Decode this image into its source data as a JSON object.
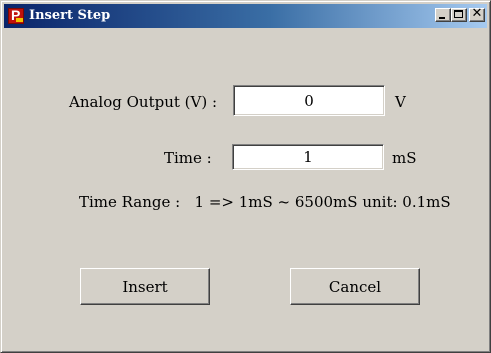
{
  "window": {
    "title": "Insert Step",
    "icon": "app-p-icon",
    "controls": {
      "minimize": "minimize-icon",
      "maximize": "maximize-icon",
      "close": "close-icon",
      "close_glyph": "✕"
    },
    "icon_letter": "P"
  },
  "form": {
    "analog_output": {
      "label": "Analog Output (V) :",
      "value": "0",
      "unit": "V"
    },
    "time": {
      "label": "Time :",
      "value": "1",
      "unit": "mS"
    },
    "time_range": "Time Range :   1 => 1mS ~ 6500mS unit: 0.1mS"
  },
  "buttons": {
    "insert": "Insert",
    "cancel": "Cancel"
  },
  "colors": {
    "title_gradient_start": "#0a246a",
    "title_gradient_end": "#a6caf0",
    "face": "#d4d0c8",
    "icon_red": "#c0120c"
  }
}
